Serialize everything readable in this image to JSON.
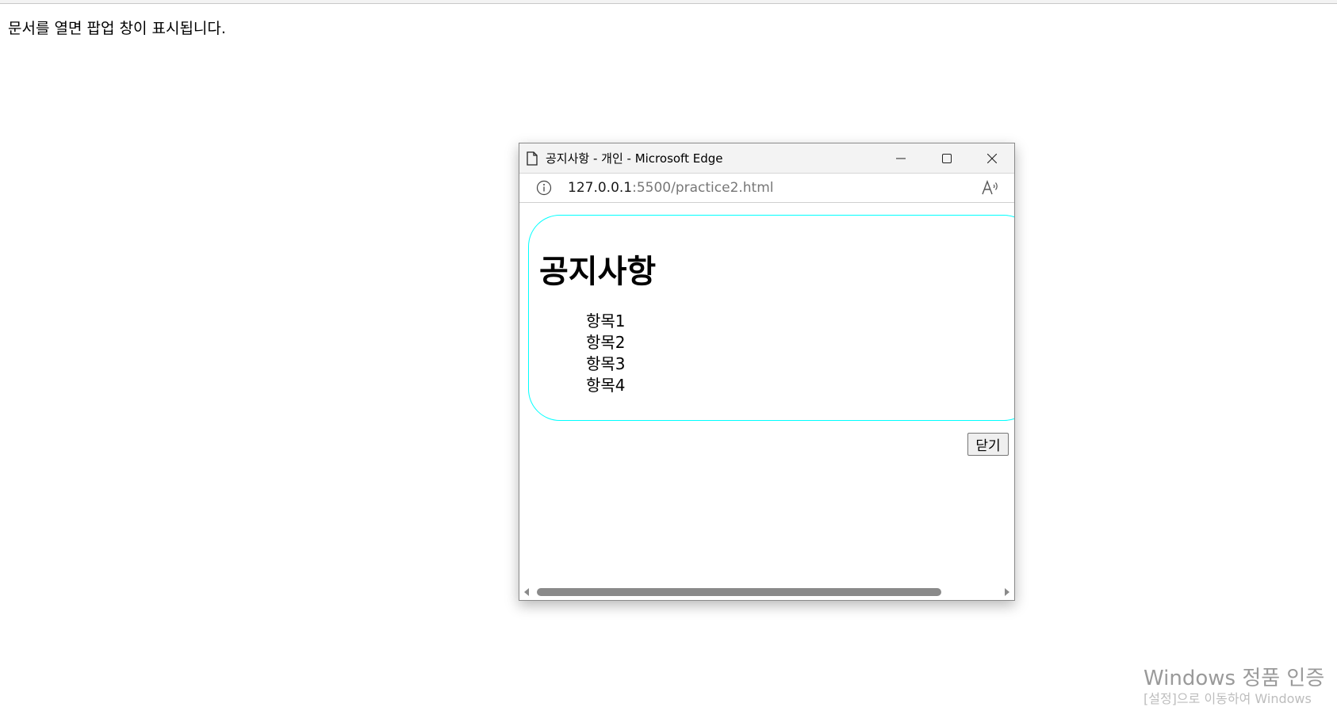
{
  "page": {
    "message": "문서를 열면 팝업 창이 표시됩니다."
  },
  "popup": {
    "title": "공지사항 - 개인 - Microsoft Edge",
    "controls": {
      "minimize_icon": "minimize-icon",
      "maximize_icon": "maximize-icon",
      "close_icon": "close-icon"
    },
    "address": {
      "host": "127.0.0.1",
      "path": ":5500/practice2.html",
      "info_icon": "info-icon",
      "read_aloud_icon": "read-aloud-icon"
    },
    "content": {
      "heading": "공지사항",
      "items": [
        "항목1",
        "항목2",
        "항목3",
        "항목4"
      ],
      "close_label": "닫기",
      "border_color": "#00ffff"
    },
    "scrollbar": {
      "thumb_fraction": 0.88
    }
  },
  "watermark": {
    "title": "Windows 정품 인증",
    "subtitle": "[설정]으로 이동하여 Windows"
  }
}
